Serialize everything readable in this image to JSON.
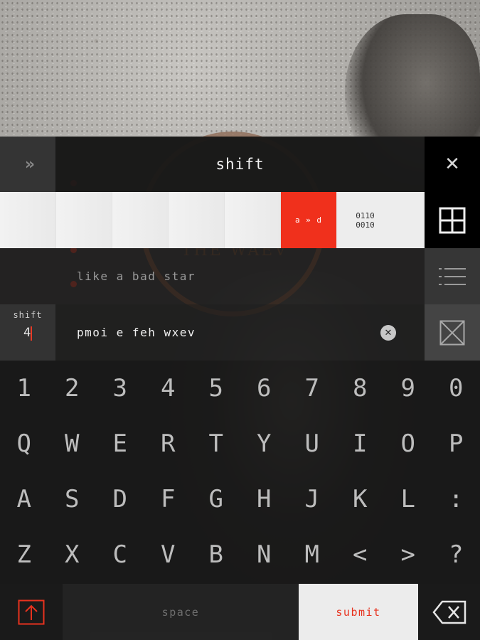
{
  "header": {
    "expand_glyph": "»",
    "title": "shift",
    "close_glyph": "✕"
  },
  "cipher_strip": {
    "active_label": "a » d",
    "binary_label": "0110\n0010"
  },
  "hint": {
    "text": "like a bad star"
  },
  "input": {
    "shift_label": "shift",
    "shift_value": "4",
    "message": "pmoi e feh wxev",
    "clear_glyph": "✕"
  },
  "keyboard": {
    "rows": [
      [
        "1",
        "2",
        "3",
        "4",
        "5",
        "6",
        "7",
        "8",
        "9",
        "0"
      ],
      [
        "Q",
        "W",
        "E",
        "R",
        "T",
        "Y",
        "U",
        "I",
        "O",
        "P"
      ],
      [
        "A",
        "S",
        "D",
        "F",
        "G",
        "H",
        "J",
        "K",
        "L",
        ":"
      ],
      [
        "Z",
        "X",
        "C",
        "V",
        "B",
        "N",
        "M",
        "<",
        ">",
        "?"
      ]
    ],
    "space_label": "space",
    "submit_label": "submit"
  },
  "colors": {
    "accent": "#f0301c",
    "panel_dark": "#1e1e1e",
    "panel_light": "#ededed"
  },
  "icons": {
    "expand": "double-chevron-right-icon",
    "close": "close-icon",
    "grid": "grid-icon",
    "list": "list-icon",
    "reset": "crossed-box-icon",
    "shift": "shift-arrow-icon",
    "backspace": "backspace-icon",
    "clear": "clear-circle-icon"
  }
}
